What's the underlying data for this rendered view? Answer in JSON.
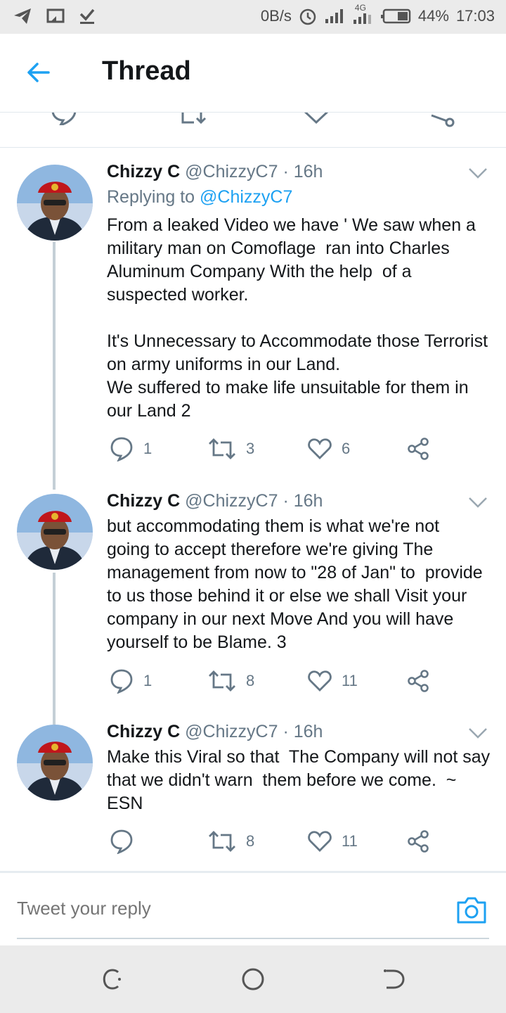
{
  "status_bar": {
    "net_speed": "0B/s",
    "network": "4G",
    "battery": "44%",
    "time": "17:03"
  },
  "header": {
    "title": "Thread"
  },
  "tweets": [
    {
      "name": "Chizzy C",
      "handle": "@ChizzyC7",
      "time": "· 16h",
      "replying_prefix": "Replying to ",
      "replying_handle": "@ChizzyC7",
      "text": "From a leaked Video we have ' We saw when a\nmilitary man on Comoflage  ran into Charles\nAluminum Company With the help  of a\nsuspected worker.\n\nIt's Unnecessary to Accommodate those Terrorist\non army uniforms in our Land.\nWe suffered to make life unsuitable for them in\nour Land 2",
      "replies": "1",
      "retweets": "3",
      "likes": "6"
    },
    {
      "name": "Chizzy C",
      "handle": "@ChizzyC7",
      "time": "· 16h",
      "text": "but accommodating them is what we're not\ngoing to accept therefore we're giving The\nmanagement from now to \"28 of Jan\" to  provide\nto us those behind it or else we shall Visit your\ncompany in our next Move And you will have\nyourself to be Blame. 3",
      "replies": "1",
      "retweets": "8",
      "likes": "11"
    },
    {
      "name": "Chizzy C",
      "handle": "@ChizzyC7",
      "time": "· 16h",
      "text": "Make this Viral so that  The Company will not say\nthat we didn't warn  them before we come.  ~\nESN",
      "replies": "",
      "retweets": "8",
      "likes": "11"
    }
  ],
  "reply_bar": {
    "placeholder": "Tweet your reply"
  },
  "colors": {
    "accent": "#1da1f2",
    "icon_gray": "#657786",
    "text": "#14171a",
    "thread_line": "#c4cfd6"
  },
  "icons": {
    "back": "arrow-left-icon",
    "reply": "speech-bubble-icon",
    "retweet": "retweet-icon",
    "like": "heart-icon",
    "share": "share-icon",
    "more": "chevron-down-icon",
    "camera": "camera-icon"
  }
}
